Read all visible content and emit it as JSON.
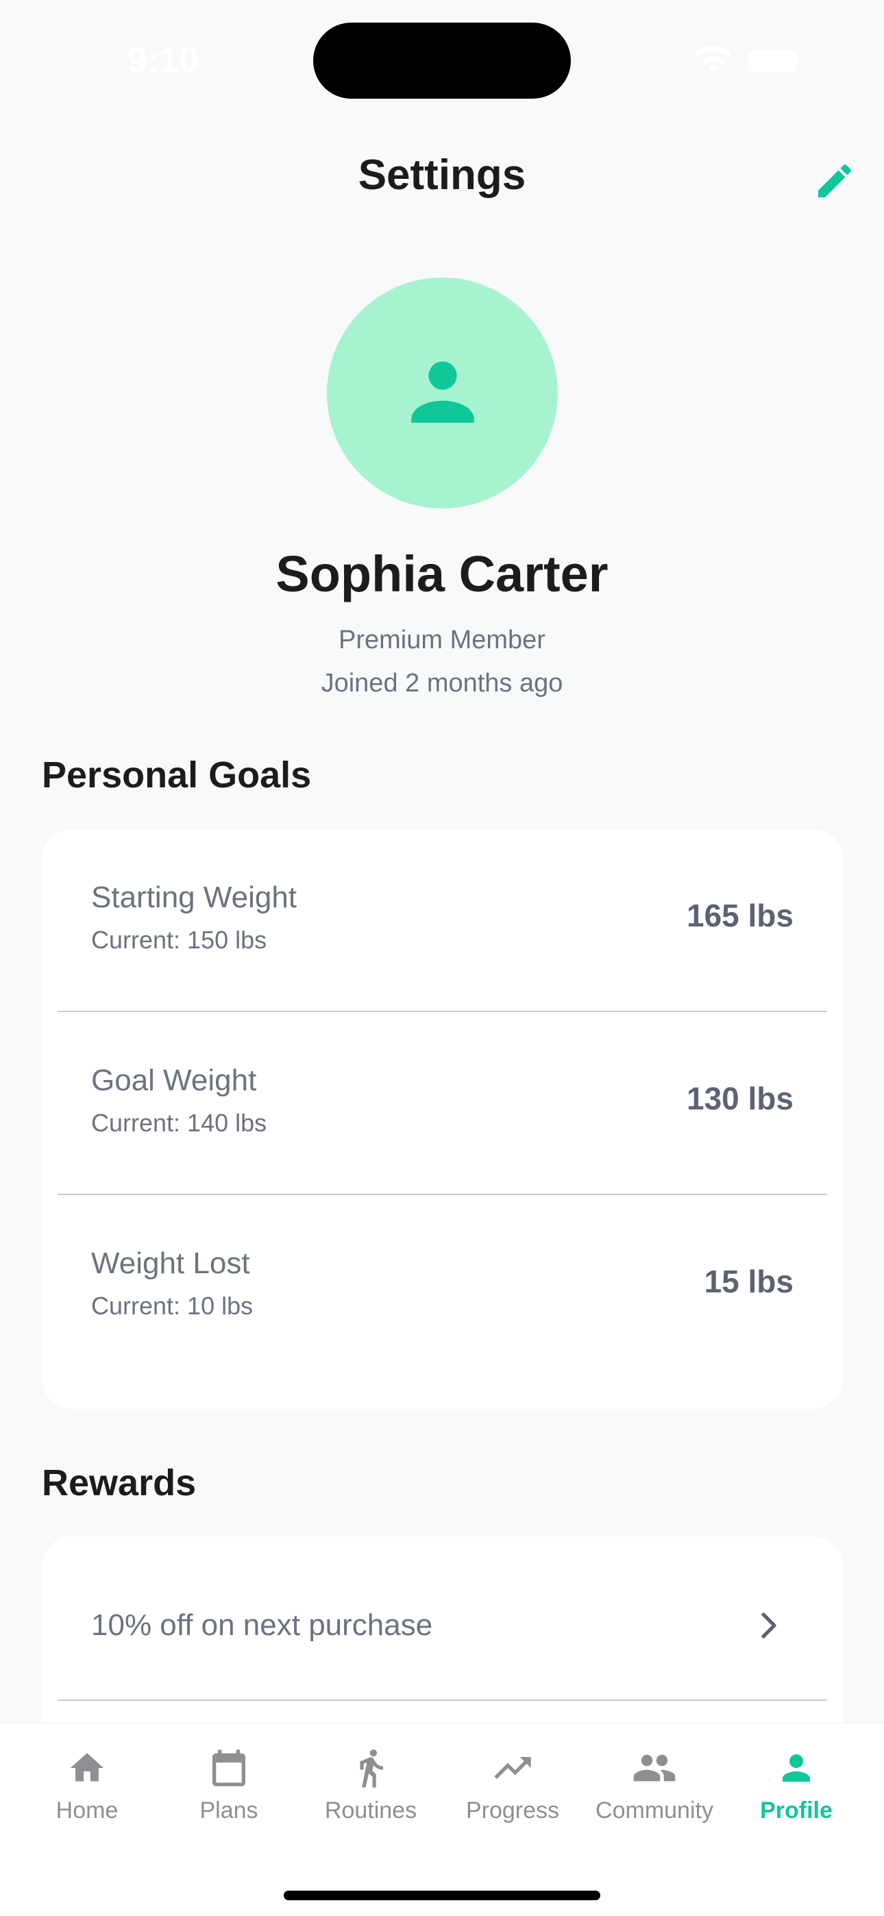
{
  "status_bar": {
    "time": "9:10"
  },
  "header": {
    "title": "Settings"
  },
  "profile": {
    "name": "Sophia Carter",
    "membership": "Premium Member",
    "joined": "Joined 2 months ago"
  },
  "personal_goals": {
    "title": "Personal Goals",
    "items": [
      {
        "label": "Starting Weight",
        "sub": "Current: 150 lbs",
        "value": "165 lbs"
      },
      {
        "label": "Goal Weight",
        "sub": "Current: 140 lbs",
        "value": "130 lbs"
      },
      {
        "label": "Weight Lost",
        "sub": "Current: 10 lbs",
        "value": "15 lbs"
      }
    ]
  },
  "rewards": {
    "title": "Rewards",
    "items": [
      {
        "label": "10% off on next purchase"
      }
    ]
  },
  "tabbar": {
    "items": [
      {
        "label": "Home",
        "icon": "home-icon"
      },
      {
        "label": "Plans",
        "icon": "calendar-icon"
      },
      {
        "label": "Routines",
        "icon": "running-icon"
      },
      {
        "label": "Progress",
        "icon": "trending-up-icon"
      },
      {
        "label": "Community",
        "icon": "people-icon"
      },
      {
        "label": "Profile",
        "icon": "person-icon"
      }
    ],
    "active": "Profile"
  },
  "colors": {
    "accent": "#10c79a",
    "avatar_bg": "#a7f3d0",
    "background": "#f8f9fb",
    "muted_text": "#6b7280",
    "inactive_tab": "#8e8e93"
  }
}
